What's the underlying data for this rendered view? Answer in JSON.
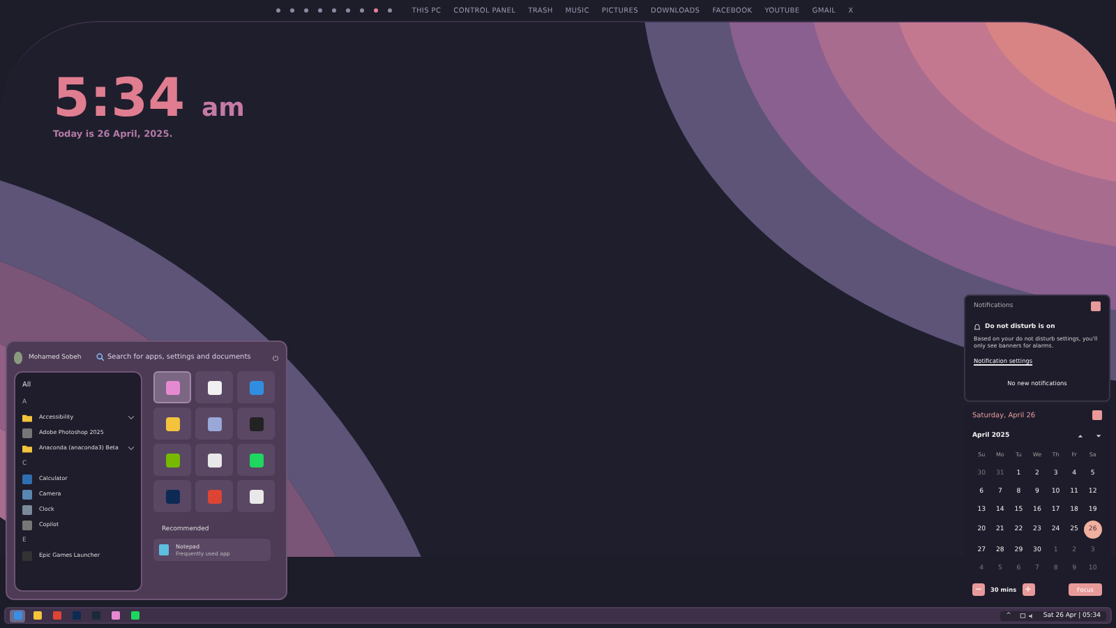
{
  "top_bar": {
    "dots": [
      {
        "selected": false
      },
      {
        "selected": false
      },
      {
        "selected": false
      },
      {
        "selected": false
      },
      {
        "selected": false
      },
      {
        "selected": false
      },
      {
        "selected": false
      },
      {
        "selected": true
      },
      {
        "selected": false
      }
    ],
    "links": [
      "THIS PC",
      "CONTROL PANEL",
      "TRASH",
      "MUSIC",
      "PICTURES",
      "DOWNLOADS",
      "FACEBOOK",
      "YOUTUBE",
      "GMAIL",
      "X"
    ]
  },
  "clock": {
    "time": "5:34",
    "ampm": "am",
    "date": "Today is 26 April, 2025."
  },
  "start_menu": {
    "user": "Mohamed Sobeh",
    "search": {
      "placeholder": "Search for apps, settings and documents"
    },
    "list": [
      {
        "kind": "heading",
        "label": "All"
      },
      {
        "kind": "letter",
        "label": "A"
      },
      {
        "kind": "folder",
        "label": "Accessibility",
        "expanded": false
      },
      {
        "kind": "app",
        "label": "Adobe Photoshop 2025"
      },
      {
        "kind": "folder",
        "label": "Anaconda (anaconda3) Beta",
        "expanded": false
      },
      {
        "kind": "letter",
        "label": "C"
      },
      {
        "kind": "app",
        "label": "Calculator"
      },
      {
        "kind": "app",
        "label": "Camera"
      },
      {
        "kind": "app",
        "label": "Clock"
      },
      {
        "kind": "app",
        "label": "Copilot"
      },
      {
        "kind": "letter",
        "label": "E"
      },
      {
        "kind": "app",
        "label": "Epic Games Launcher"
      }
    ],
    "pinned": [
      {
        "selected": true
      },
      {
        "selected": false
      },
      {
        "selected": false
      },
      {
        "selected": false
      },
      {
        "selected": false
      },
      {
        "selected": false
      },
      {
        "selected": false
      },
      {
        "selected": false
      },
      {
        "selected": false
      },
      {
        "selected": false
      },
      {
        "selected": false
      },
      {
        "selected": false
      }
    ],
    "recommended": {
      "title": "Recommended",
      "items": [
        {
          "name": "Notepad",
          "detail": "Frequently used app"
        }
      ]
    }
  },
  "notifications": {
    "title": "Notifications",
    "dnd_title": "Do not disturb is on",
    "dnd_text": "Based on your do not disturb settings, you'll only see banners for alarms.",
    "settings_link": "Notification settings",
    "empty": "No new notifications"
  },
  "calendar": {
    "date": "Saturday, April 26",
    "month": "April 2025",
    "weekdays": [
      "Su",
      "Mo",
      "Tu",
      "We",
      "Th",
      "Fr",
      "Sa"
    ],
    "weeks": [
      [
        {
          "day": "30",
          "in_month": false,
          "selected": false
        },
        {
          "day": "31",
          "in_month": false,
          "selected": false
        },
        {
          "day": "1",
          "in_month": true,
          "selected": false
        },
        {
          "day": "2",
          "in_month": true,
          "selected": false
        },
        {
          "day": "3",
          "in_month": true,
          "selected": false
        },
        {
          "day": "4",
          "in_month": true,
          "selected": false
        },
        {
          "day": "5",
          "in_month": true,
          "selected": false
        }
      ],
      [
        {
          "day": "6",
          "in_month": true,
          "selected": false
        },
        {
          "day": "7",
          "in_month": true,
          "selected": false
        },
        {
          "day": "8",
          "in_month": true,
          "selected": false
        },
        {
          "day": "9",
          "in_month": true,
          "selected": false
        },
        {
          "day": "10",
          "in_month": true,
          "selected": false
        },
        {
          "day": "11",
          "in_month": true,
          "selected": false
        },
        {
          "day": "12",
          "in_month": true,
          "selected": false
        }
      ],
      [
        {
          "day": "13",
          "in_month": true,
          "selected": false
        },
        {
          "day": "14",
          "in_month": true,
          "selected": false
        },
        {
          "day": "15",
          "in_month": true,
          "selected": false
        },
        {
          "day": "16",
          "in_month": true,
          "selected": false
        },
        {
          "day": "17",
          "in_month": true,
          "selected": false
        },
        {
          "day": "18",
          "in_month": true,
          "selected": false
        },
        {
          "day": "19",
          "in_month": true,
          "selected": false
        }
      ],
      [
        {
          "day": "20",
          "in_month": true,
          "selected": false
        },
        {
          "day": "21",
          "in_month": true,
          "selected": false
        },
        {
          "day": "22",
          "in_month": true,
          "selected": false
        },
        {
          "day": "23",
          "in_month": true,
          "selected": false
        },
        {
          "day": "24",
          "in_month": true,
          "selected": false
        },
        {
          "day": "25",
          "in_month": true,
          "selected": false
        },
        {
          "day": "26",
          "in_month": true,
          "selected": true
        }
      ],
      [
        {
          "day": "27",
          "in_month": true,
          "selected": false
        },
        {
          "day": "28",
          "in_month": true,
          "selected": false
        },
        {
          "day": "29",
          "in_month": true,
          "selected": false
        },
        {
          "day": "30",
          "in_month": true,
          "selected": false
        },
        {
          "day": "1",
          "in_month": false,
          "selected": false
        },
        {
          "day": "2",
          "in_month": false,
          "selected": false
        },
        {
          "day": "3",
          "in_month": false,
          "selected": false
        }
      ],
      [
        {
          "day": "4",
          "in_month": false,
          "selected": false
        },
        {
          "day": "5",
          "in_month": false,
          "selected": false
        },
        {
          "day": "6",
          "in_month": false,
          "selected": false
        },
        {
          "day": "7",
          "in_month": false,
          "selected": false
        },
        {
          "day": "8",
          "in_month": false,
          "selected": false
        },
        {
          "day": "9",
          "in_month": false,
          "selected": false
        },
        {
          "day": "10",
          "in_month": false,
          "selected": false
        }
      ]
    ],
    "focus": {
      "minus": "−",
      "duration": "30 mins",
      "plus": "+",
      "button": "Focus"
    }
  },
  "taskbar": {
    "apps": [
      {
        "selected": true
      },
      {
        "selected": false
      },
      {
        "selected": false
      },
      {
        "selected": false
      },
      {
        "selected": false
      },
      {
        "selected": false
      },
      {
        "selected": false
      }
    ],
    "tray_caret": "^",
    "datetime": "Sat 26 Apr | 05:34"
  }
}
